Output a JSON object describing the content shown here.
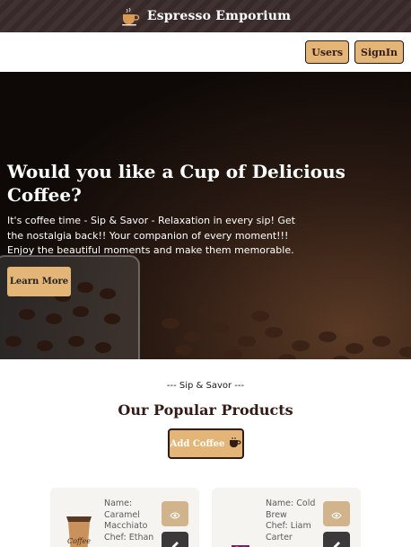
{
  "header": {
    "title": "Espresso Emporium",
    "logo_icon": "coffee-cup-logo-icon"
  },
  "nav": {
    "users_label": "Users",
    "signin_label": "SignIn"
  },
  "hero": {
    "title": "Would you like a Cup of Delicious Coffee?",
    "text": "It's coffee time - Sip & Savor - Relaxation in every sip! Get the nostalgia back!! Your companion of every moment!!! Enjoy the beautiful moments and make them memorable.",
    "learn_more_label": "Learn More"
  },
  "products": {
    "subtitle": "--- Sip & Savor ---",
    "title": "Our Popular Products",
    "add_label": "Add Coffee",
    "add_icon": "coffee-cup-icon",
    "items": [
      {
        "name_line": "Name: Caramel Macchiato",
        "chef_line": "Chef: Ethan",
        "cup_text": "Coffee"
      },
      {
        "name_line": "Name: Cold Brew",
        "chef_line": "Chef: Liam Carter"
      }
    ]
  },
  "colors": {
    "header_bg": "#3a2b2b",
    "accent": "#e3b577",
    "card_bg": "#f5f4f1",
    "view_btn": "#d2b48c",
    "edit_btn": "#3c393b"
  }
}
